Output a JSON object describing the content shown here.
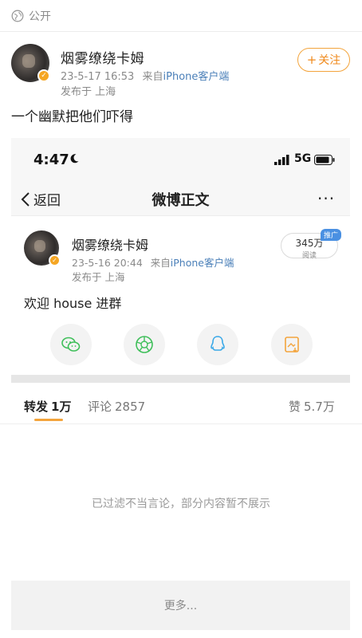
{
  "visibility": {
    "label": "公开",
    "icon": "globe-icon"
  },
  "post": {
    "author": "烟雾缭绕卡姆",
    "date": "23-5-17 16:53",
    "from_prefix": "来自",
    "source": "iPhone客户端",
    "location": "发布于 上海",
    "follow_label": "关注",
    "text": "一个幽默把他们吓得"
  },
  "screenshot": {
    "status": {
      "time": "4:47",
      "network": "5G"
    },
    "nav": {
      "back_label": "返回",
      "title": "微博正文",
      "more": "···"
    },
    "post": {
      "author": "烟雾缭绕卡姆",
      "date": "23-5-16 20:44",
      "from_prefix": "来自",
      "source": "iPhone客户端",
      "location": "发布于 上海",
      "reads_count": "345万",
      "reads_label": "阅读",
      "promo_tag": "推广",
      "text": "欢迎 house 进群"
    },
    "share_icons": [
      "wechat-icon",
      "moments-icon",
      "qq-icon",
      "save-image-icon"
    ]
  },
  "tabs": [
    {
      "label": "转发",
      "count": "1万"
    },
    {
      "label": "评论",
      "count": "2857"
    },
    {
      "label": "赞",
      "count": "5.7万"
    }
  ],
  "filtered_note": "已过滤不当言论，部分内容暂不展示",
  "more_label": "更多...",
  "colors": {
    "accent": "#f3a43c",
    "link": "#4a7fb8",
    "promo": "#4a90e2"
  }
}
